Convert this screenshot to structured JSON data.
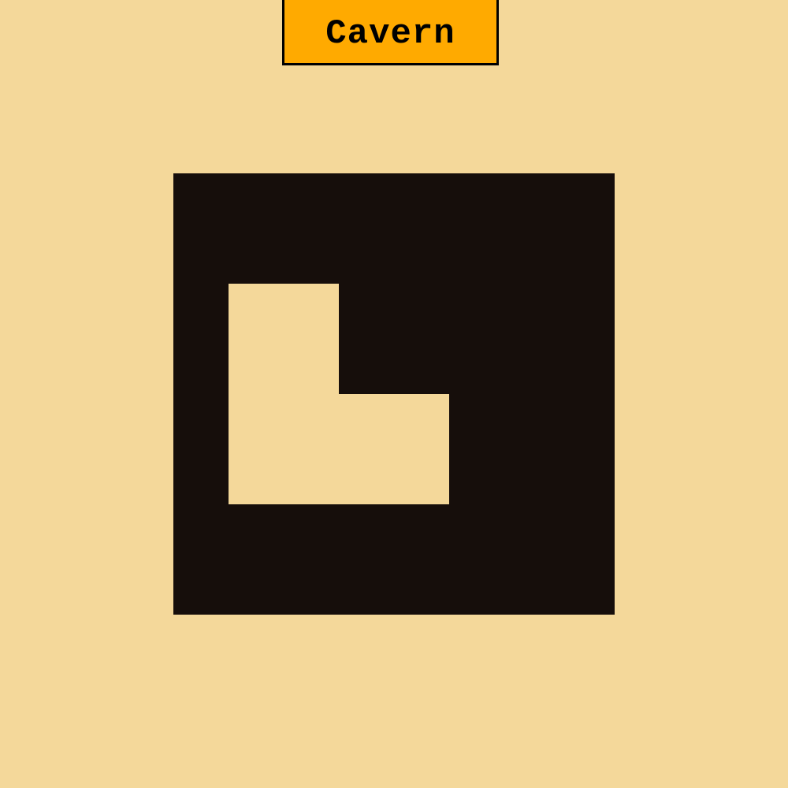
{
  "title": "Cavern",
  "colors": {
    "background": "#f4d89a",
    "title_fill": "#ffaa00",
    "title_border": "#000000",
    "wall": "#160e0b",
    "floor": "#f4d89a"
  },
  "map": {
    "legend": {
      "1": "wall",
      "0": "floor"
    },
    "rows": [
      "11111111",
      "11111111",
      "10011111",
      "10011111",
      "10000111",
      "10000111",
      "11111111",
      "11111111"
    ]
  }
}
